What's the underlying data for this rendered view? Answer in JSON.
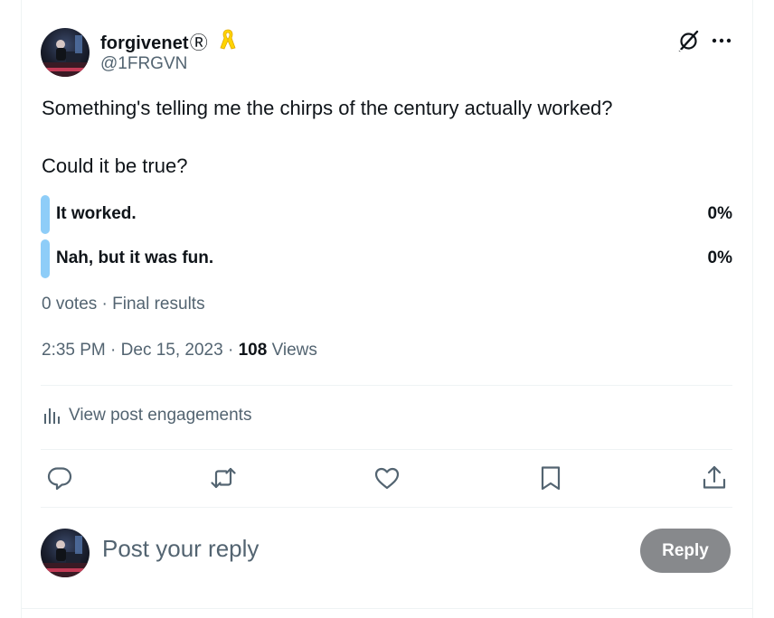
{
  "post": {
    "author": {
      "display_name": "forgivenet",
      "badge": "Ⓡ",
      "handle": "@1FRGVN",
      "ribbon_icon": "yellow-ribbon-icon"
    },
    "text_line1": "Something's telling me the chirps of the century actually worked?",
    "text_line2": "Could it be true?",
    "poll": {
      "options": [
        {
          "label": "It worked.",
          "percent": "0%"
        },
        {
          "label": "Nah, but it was fun.",
          "percent": "0%"
        }
      ],
      "meta": "0 votes · Final results"
    },
    "time": "2:35 PM",
    "separator": "·",
    "date": "Dec 15, 2023",
    "views_count": "108",
    "views_label": "Views",
    "engagements_label": "View post engagements",
    "actions": [
      "reply-icon",
      "repost-icon",
      "like-icon",
      "bookmark-icon",
      "share-icon"
    ]
  },
  "reply_box": {
    "placeholder": "Post your reply",
    "button_label": "Reply"
  },
  "colors": {
    "accent_bar": "#8ecdf8",
    "muted_text": "#536471",
    "primary_text": "#0f1419",
    "reply_button_disabled": "#87898c",
    "ribbon": "#ffd400"
  }
}
